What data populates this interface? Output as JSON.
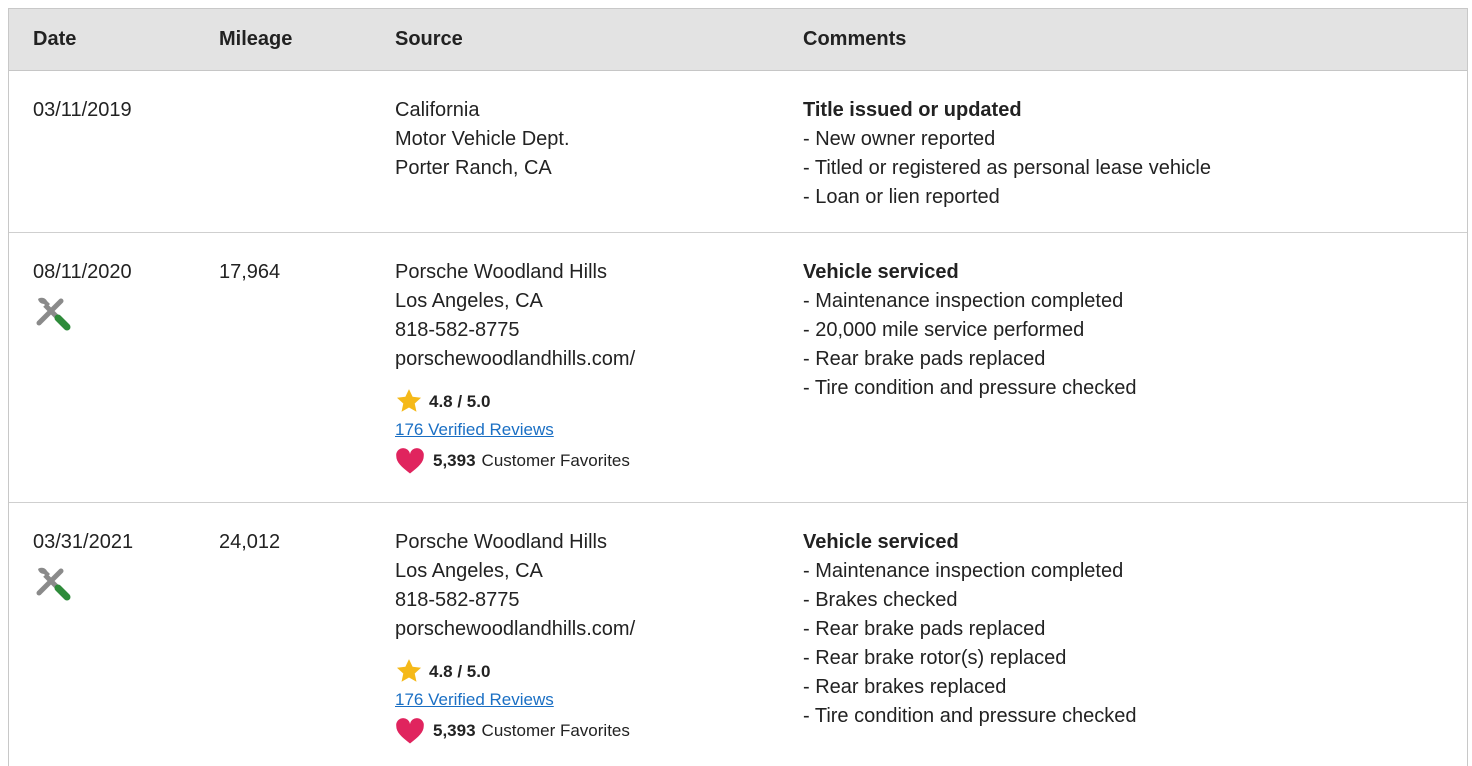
{
  "header": {
    "date": "Date",
    "mileage": "Mileage",
    "source": "Source",
    "comments": "Comments"
  },
  "rows": [
    {
      "date": "03/11/2019",
      "mileage": "",
      "source": [
        "California",
        "Motor Vehicle Dept.",
        "Porter Ranch, CA"
      ],
      "comment_title": "Title issued or updated",
      "comments": [
        "- New owner reported",
        "- Titled or registered as personal lease vehicle",
        "- Loan or lien reported"
      ]
    },
    {
      "date": "08/11/2020",
      "icon": "service-tools-icon",
      "mileage": "17,964",
      "source": [
        "Porsche Woodland Hills",
        "Los Angeles, CA",
        "818-582-8775",
        "porschewoodlandhills.com/"
      ],
      "rating": "4.8 / 5.0",
      "reviews": "176 Verified Reviews",
      "favorites_count": "5,393",
      "favorites_label": "Customer Favorites",
      "comment_title": "Vehicle serviced",
      "comments": [
        "- Maintenance inspection completed",
        "- 20,000 mile service performed",
        "- Rear brake pads replaced",
        "- Tire condition and pressure checked"
      ]
    },
    {
      "date": "03/31/2021",
      "icon": "service-tools-icon",
      "mileage": "24,012",
      "source": [
        "Porsche Woodland Hills",
        "Los Angeles, CA",
        "818-582-8775",
        "porschewoodlandhills.com/"
      ],
      "rating": "4.8 / 5.0",
      "reviews": "176 Verified Reviews",
      "favorites_count": "5,393",
      "favorites_label": "Customer Favorites",
      "comment_title": "Vehicle serviced",
      "comments": [
        "- Maintenance inspection completed",
        "- Brakes checked",
        "- Rear brake pads replaced",
        "- Rear brake rotor(s) replaced",
        "- Rear brakes replaced",
        "- Tire condition and pressure checked"
      ]
    }
  ],
  "colors": {
    "header_bg": "#e3e3e3",
    "link": "#1a6fc4",
    "star": "#f5b919",
    "heart": "#e0245e",
    "wrench_handle": "#2e8b3a",
    "tool_gray": "#8a8a8a"
  }
}
